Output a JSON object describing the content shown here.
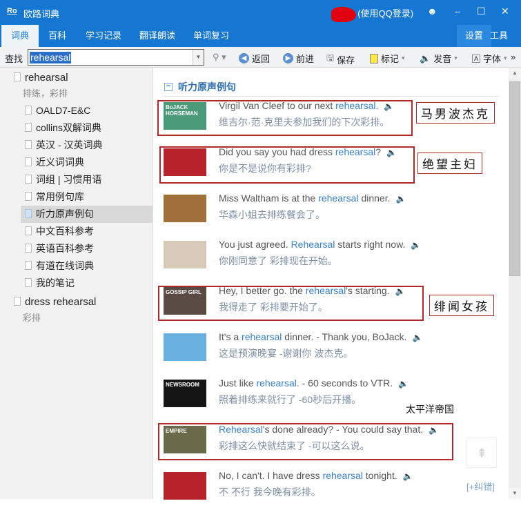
{
  "app": {
    "logo": "Ro",
    "title": "欧路词典",
    "login": "(使用QQ登录)"
  },
  "window": {
    "smile": "☻",
    "min": "–",
    "max": "☐",
    "close": "✕"
  },
  "tabs": [
    "词典",
    "百科",
    "学习记录",
    "翻译朗读",
    "单词复习"
  ],
  "tabs_right": {
    "settings": "设置",
    "tools": "工具 ▾"
  },
  "toolbar": {
    "find_label": "查找",
    "query": "rehearsal",
    "back": "返回",
    "forward": "前进",
    "save": "保存",
    "mark": "标记",
    "speak": "发音",
    "font": "字体",
    "more": "»"
  },
  "sidebar": {
    "entry1": {
      "word": "rehearsal",
      "meaning": "排练，彩排"
    },
    "items": [
      "OALD7-E&C",
      "collins双解词典",
      "英汉 - 汉英词典",
      "近义词词典",
      "词组 | 习惯用语",
      "常用例句库",
      "听力原声例句",
      "中文百科参考",
      "英语百科参考",
      "有道在线词典",
      "我的笔记"
    ],
    "active_index": 6,
    "entry2": {
      "word": "dress rehearsal",
      "meaning": "彩排"
    }
  },
  "section_title": "听力原声例句",
  "sentences": [
    {
      "pre": "Virgil Van Cleef to our next ",
      "kw": "rehearsal",
      "post": ".",
      "zh": "维吉尔·范·克里夫参加我们的下次彩排。",
      "thumb": "BoJACK HORSEMAN",
      "color": "#4a9a7a"
    },
    {
      "pre": "Did you say you had dress ",
      "kw": "rehearsal",
      "post": "?",
      "zh": "你是不是说你有彩排?",
      "thumb": "",
      "color": "#b8222a"
    },
    {
      "pre": "Miss Waltham is at the ",
      "kw": "rehearsal",
      "post": " dinner.",
      "zh": "华森小姐去排练餐会了。",
      "thumb": "",
      "color": "#a0703a"
    },
    {
      "pre": "You just agreed. ",
      "kw": "Rehearsal",
      "post": " starts right now.",
      "zh": "你刚同意了 彩排现在开始。",
      "thumb": "",
      "color": "#d8c8b8"
    },
    {
      "pre": "Hey, I better go. the ",
      "kw": "rehearsal",
      "post": "'s starting.",
      "zh": "我得走了 彩排要开始了。",
      "thumb": "GOSSIP GIRL",
      "color": "#5a4a44"
    },
    {
      "pre": "It's a ",
      "kw": "rehearsal",
      "post": " dinner. - Thank you, BoJack.",
      "zh": "这是预演晚宴 -谢谢你 波杰克。",
      "thumb": "",
      "color": "#6ab0e0"
    },
    {
      "pre": "Just like ",
      "kw": "rehearsal",
      "post": ". - 60 seconds to VTR.",
      "zh": "照着排练来就行了 -60秒后开播。",
      "thumb": "NEWSROOM",
      "color": "#151515"
    },
    {
      "pre": "",
      "kw": "Rehearsal",
      "post": "'s done already? - You could say that.",
      "zh": "彩排这么快就结束了 -可以这么说。",
      "thumb": "EMPIRE",
      "color": "#6a6a4a"
    },
    {
      "pre": "No, I can't. I have dress ",
      "kw": "rehearsal",
      "post": " tonight.",
      "zh": "不 不行 我今晚有彩排。",
      "thumb": "",
      "color": "#b8222a"
    }
  ],
  "annotations": [
    "马男波杰克",
    "绝望主妇",
    "绯闻女孩",
    "太平洋帝国"
  ],
  "fix_link": "[+纠错]"
}
